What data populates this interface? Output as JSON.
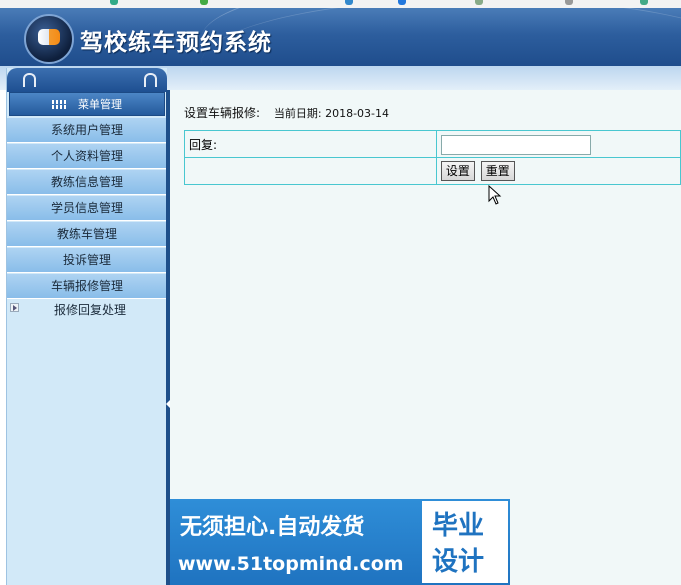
{
  "header": {
    "title": "驾校练车预约系统"
  },
  "sidebar": {
    "menu_title": "菜单管理",
    "items": [
      {
        "label": "系统用户管理"
      },
      {
        "label": "个人资料管理"
      },
      {
        "label": "教练信息管理"
      },
      {
        "label": "学员信息管理"
      },
      {
        "label": "教练车管理"
      },
      {
        "label": "投诉管理"
      },
      {
        "label": "车辆报修管理"
      }
    ],
    "sub_item": {
      "label": "报修回复处理"
    }
  },
  "main": {
    "crumb": "设置车辆报修:",
    "date_label": "当前日期:",
    "date_value": "2018-03-14",
    "form": {
      "reply_label": "回复:",
      "reply_value": "",
      "submit_label": "设置",
      "reset_label": "重置"
    }
  },
  "ad": {
    "line1": "无须担心.自动发货",
    "line2": "www.51topmind.com",
    "badge_line1": "毕业",
    "badge_line2": "设计"
  }
}
